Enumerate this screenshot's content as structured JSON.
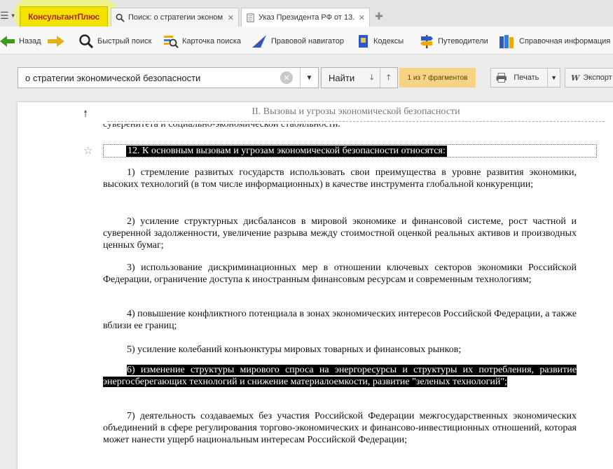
{
  "app": {
    "logo_text": "КонсультантПлюс",
    "menu_icon": "hamburger-icon"
  },
  "tabs": [
    {
      "label": "Поиск: о стратегии эконом",
      "icon": "search-icon",
      "active": false
    },
    {
      "label": "Указ Президента РФ от 13.",
      "icon": "document-icon",
      "active": true
    }
  ],
  "toolbar": {
    "back_label": "Назад",
    "quick_search": "Быстрый поиск",
    "search_card": "Карточка поиска",
    "legal_navigator": "Правовой навигатор",
    "codes": "Кодексы",
    "guides": "Путеводители",
    "reference": "Справочная информация"
  },
  "search": {
    "query": "о стратегии экономической безопасности",
    "find_label": "Найти",
    "fragments_status": "1 из 7 фрагментов",
    "print_label": "Печать",
    "export_label": "Экспорт"
  },
  "document": {
    "section_heading": "II. Вызовы и угрозы экономической безопасности",
    "cut_line": "суверенитета и социально-экономической стабильности.",
    "heading": "12. К основным вызовам и угрозам экономической безопасности относятся:",
    "p1": "1) стремление развитых государств использовать свои преимущества в уровне развития экономики, высоких технологий (в том числе информационных) в качестве инструмента глобальной конкуренции;",
    "p2": "2) усиление структурных дисбалансов в мировой экономике и финансовой системе, рост частной и суверенной задолженности, увеличение разрыва между стоимостной оценкой реальных активов и производных ценных бумаг;",
    "p3": "3) использование дискриминационных мер в отношении ключевых секторов экономики Российской Федерации, ограничение доступа к иностранным финансовым ресурсам и современным технологиям;",
    "p4": "4) повышение конфликтного потенциала в зонах экономических интересов Российской Федерации, а также вблизи ее границ;",
    "p5": "5) усиление колебаний конъюнктуры мировых товарных и финансовых рынков;",
    "p6": "6) изменение структуры мирового спроса на энергоресурсы и структуры их потребления, развитие энергосберегающих технологий и снижение материалоемкости, развитие \"зеленых технологий\";",
    "p7": "7) деятельность создаваемых без участия Российской Федерации межгосударственных экономических объединений в сфере регулирования торгово-экономических и финансово-инвестиционных отношений, которая может нанести ущерб национальным интересам Российской Федерации;"
  },
  "colors": {
    "logo_bg": "#f3e200",
    "logo_text": "#b3261e",
    "fragment_badge": "#f5d284",
    "selection": "#000000"
  }
}
